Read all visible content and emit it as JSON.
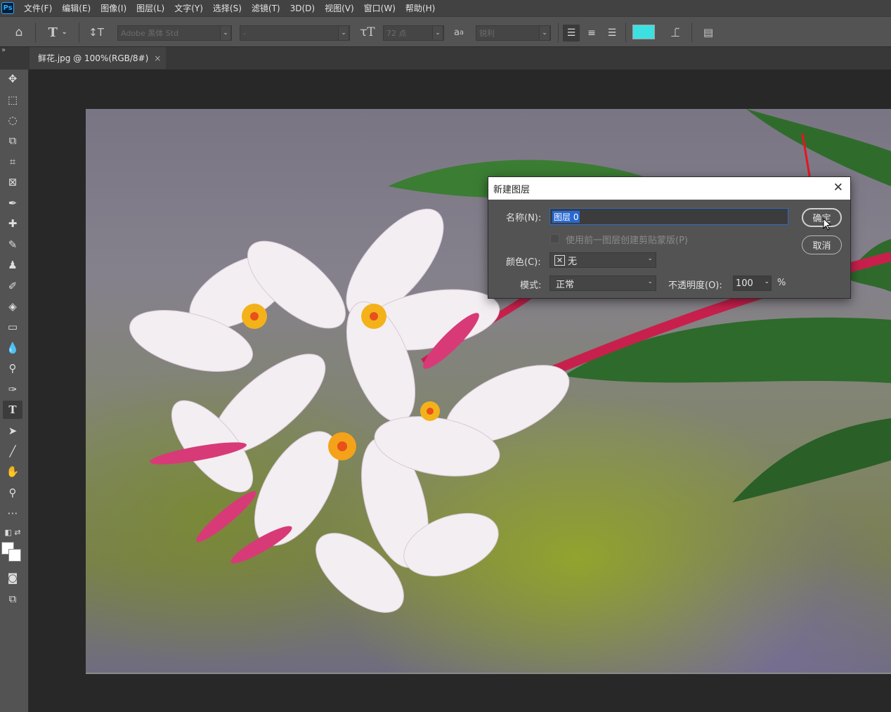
{
  "menubar": {
    "logo": "Ps",
    "items": [
      "文件(F)",
      "编辑(E)",
      "图像(I)",
      "图层(L)",
      "文字(Y)",
      "选择(S)",
      "滤镜(T)",
      "3D(D)",
      "视图(V)",
      "窗口(W)",
      "帮助(H)"
    ]
  },
  "options": {
    "font_family": "Adobe 黑体 Std",
    "font_style": "-",
    "font_size": "72 点",
    "antialias_prefix": "a",
    "antialias_prefix2": "a",
    "antialias": "锐利",
    "text_color": "#3de0e0"
  },
  "tab": {
    "title": "鲜花.jpg @ 100%(RGB/8#)",
    "close": "×"
  },
  "dialog": {
    "title": "新建图层",
    "close": "✕",
    "name_label": "名称(N):",
    "name_value": "图层 0",
    "clip_checkbox_label": "使用前一图层创建剪贴蒙版(P)",
    "color_label": "颜色(C):",
    "color_value": "无",
    "mode_label": "模式:",
    "mode_value": "正常",
    "opacity_label": "不透明度(O):",
    "opacity_value": "100",
    "opacity_unit": "%",
    "ok_button": "确定",
    "cancel_button": "取消"
  }
}
